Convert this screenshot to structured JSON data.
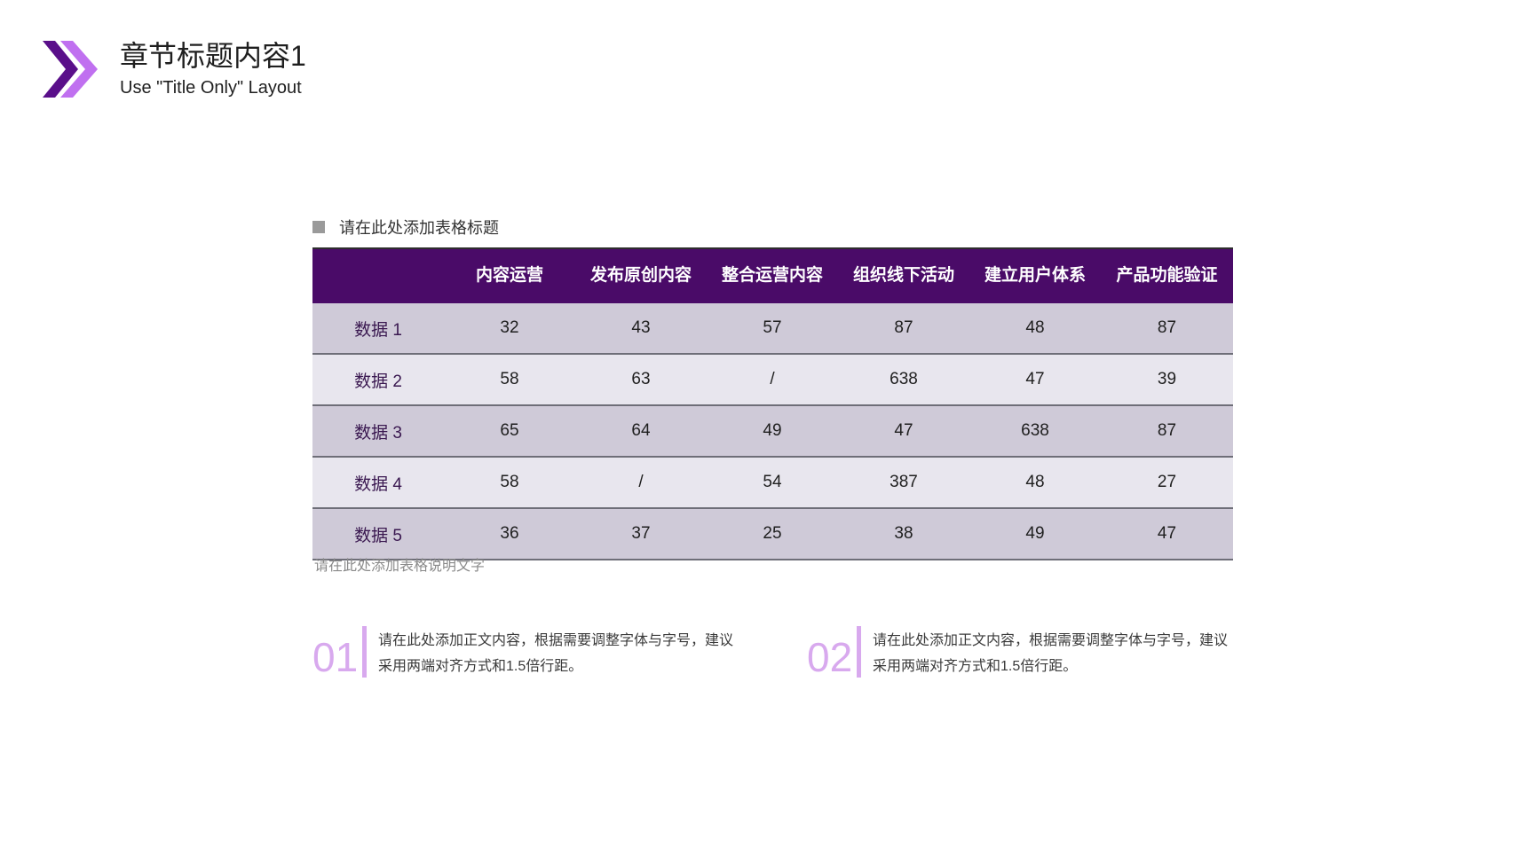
{
  "header": {
    "title": "章节标题内容1",
    "subtitle": "Use \"Title Only\" Layout",
    "logo_icon": "double-chevron-right-icon"
  },
  "colors": {
    "header_bg": "#4a0b68",
    "row_odd": "#cfcad8",
    "row_even": "#e8e6ee",
    "accent": "#d8a9ee",
    "logo_dark": "#5a0f8a",
    "logo_light": "#c070f0"
  },
  "table": {
    "caption": "请在此处添加表格标题",
    "columns": [
      "",
      "内容运营",
      "发布原创内容",
      "整合运营内容",
      "组织线下活动",
      "建立用户体系",
      "产品功能验证"
    ],
    "rows": [
      {
        "label": "数据  1",
        "values": [
          "32",
          "43",
          "57",
          "87",
          "48",
          "87"
        ]
      },
      {
        "label": "数据  2",
        "values": [
          "58",
          "63",
          "/",
          "638",
          "47",
          "39"
        ]
      },
      {
        "label": "数据  3",
        "values": [
          "65",
          "64",
          "49",
          "47",
          "638",
          "87"
        ]
      },
      {
        "label": "数据  4",
        "values": [
          "58",
          "/",
          "54",
          "387",
          "48",
          "27"
        ]
      },
      {
        "label": "数据  5",
        "values": [
          "36",
          "37",
          "25",
          "38",
          "49",
          "47"
        ]
      }
    ],
    "note": "请在此处添加表格说明文字"
  },
  "blocks": [
    {
      "number": "01",
      "text": "请在此处添加正文内容，根据需要调整字体与字号，建议采用两端对齐方式和1.5倍行距。"
    },
    {
      "number": "02",
      "text": "请在此处添加正文内容，根据需要调整字体与字号，建议采用两端对齐方式和1.5倍行距。"
    }
  ]
}
